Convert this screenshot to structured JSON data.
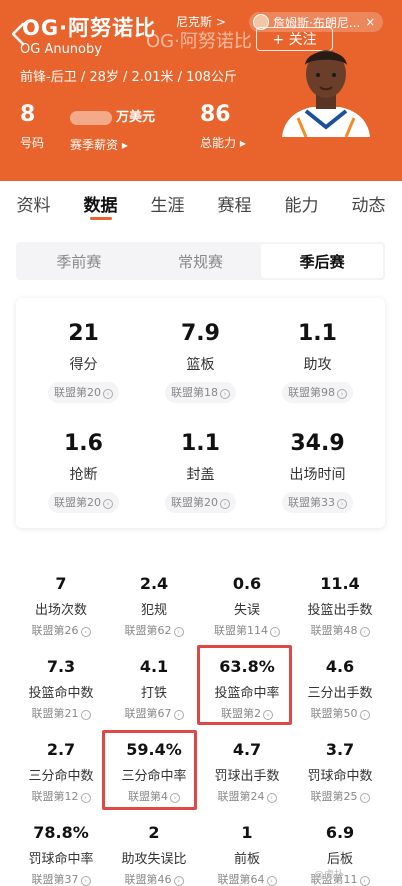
{
  "header": {
    "back_icon": "chevron-left-icon",
    "name_cn": "OG·阿努诺比",
    "name_cn_ghost": "OG·阿努诺比",
    "name_en": "OG Anunoby",
    "meta": "前锋-后卫 / 28岁 / 2.01米 / 108公斤",
    "team_link": "尼克斯 >",
    "coach_name": "詹姆斯·布朗尼...",
    "coach_close": "×",
    "follow_label": "+ 关注",
    "number": {
      "value": "8",
      "label": "号码"
    },
    "salary": {
      "value_unit": "万美元",
      "label": "赛季薪资 ▸"
    },
    "ability": {
      "value": "86",
      "label": "总能力 ▸"
    },
    "accent_color": "#e8642c"
  },
  "tabs": [
    "资料",
    "数据",
    "生涯",
    "赛程",
    "能力",
    "动态"
  ],
  "active_tab": "数据",
  "season_segments": [
    "季前赛",
    "常规赛",
    "季后赛"
  ],
  "active_segment": "季后赛",
  "main_stats": [
    {
      "value": "21",
      "label": "得分",
      "rank": "联盟第20"
    },
    {
      "value": "7.9",
      "label": "篮板",
      "rank": "联盟第18"
    },
    {
      "value": "1.1",
      "label": "助攻",
      "rank": "联盟第98"
    },
    {
      "value": "1.6",
      "label": "抢断",
      "rank": "联盟第20"
    },
    {
      "value": "1.1",
      "label": "封盖",
      "rank": "联盟第20"
    },
    {
      "value": "34.9",
      "label": "出场时间",
      "rank": "联盟第33"
    }
  ],
  "detail_stats": [
    {
      "value": "7",
      "label": "出场次数",
      "rank": "联盟第26"
    },
    {
      "value": "2.4",
      "label": "犯规",
      "rank": "联盟第62"
    },
    {
      "value": "0.6",
      "label": "失误",
      "rank": "联盟第114"
    },
    {
      "value": "11.4",
      "label": "投篮出手数",
      "rank": "联盟第48"
    },
    {
      "value": "7.3",
      "label": "投篮命中数",
      "rank": "联盟第21"
    },
    {
      "value": "4.1",
      "label": "打铁",
      "rank": "联盟第67"
    },
    {
      "value": "63.8%",
      "label": "投篮命中率",
      "rank": "联盟第2"
    },
    {
      "value": "4.6",
      "label": "三分出手数",
      "rank": "联盟第50"
    },
    {
      "value": "2.7",
      "label": "三分命中数",
      "rank": "联盟第12"
    },
    {
      "value": "59.4%",
      "label": "三分命中率",
      "rank": "联盟第4"
    },
    {
      "value": "4.7",
      "label": "罚球出手数",
      "rank": "联盟第24"
    },
    {
      "value": "3.7",
      "label": "罚球命中数",
      "rank": "联盟第25"
    },
    {
      "value": "78.8%",
      "label": "罚球命中率",
      "rank": "联盟第37"
    },
    {
      "value": "2",
      "label": "助攻失误比",
      "rank": "联盟第46"
    },
    {
      "value": "1",
      "label": "前板",
      "rank": "联盟第64"
    },
    {
      "value": "6.9",
      "label": "后板",
      "rank": "联盟第11"
    }
  ],
  "highlight_color": "#e04848",
  "watermark": "@虎扑"
}
